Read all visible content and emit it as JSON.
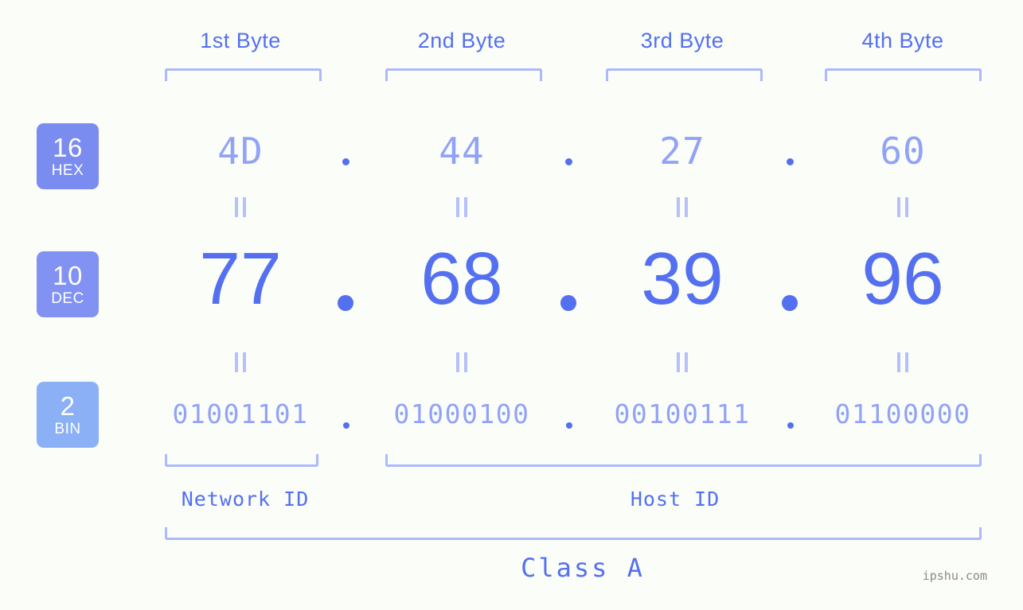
{
  "page": {
    "background_color": "#fafdf8",
    "accent_dark": "#5470f0",
    "accent_light": "#92a3f7",
    "bracket_color": "#aeb9fb",
    "watermark": "ipshu.com"
  },
  "byte_headers": [
    {
      "label": "1st Byte"
    },
    {
      "label": "2nd Byte"
    },
    {
      "label": "3rd Byte"
    },
    {
      "label": "4th Byte"
    }
  ],
  "rows": {
    "hex": {
      "badge_number": "16",
      "badge_name": "HEX",
      "badge_color": "#7b8cf0",
      "values": [
        "4D",
        "44",
        "27",
        "60"
      ],
      "separator": "."
    },
    "dec": {
      "badge_number": "10",
      "badge_name": "DEC",
      "badge_color": "#8192f2",
      "values": [
        "77",
        "68",
        "39",
        "96"
      ],
      "separator": "."
    },
    "bin": {
      "badge_number": "2",
      "badge_name": "BIN",
      "badge_color": "#8cb0f5",
      "values": [
        "01001101",
        "01000100",
        "00100111",
        "01100000"
      ],
      "separator": "."
    }
  },
  "equality_marks": {
    "symbol": "||",
    "count_per_row": 4
  },
  "segments": {
    "network_id": "Network ID",
    "host_id": "Host ID",
    "class": "Class A"
  }
}
